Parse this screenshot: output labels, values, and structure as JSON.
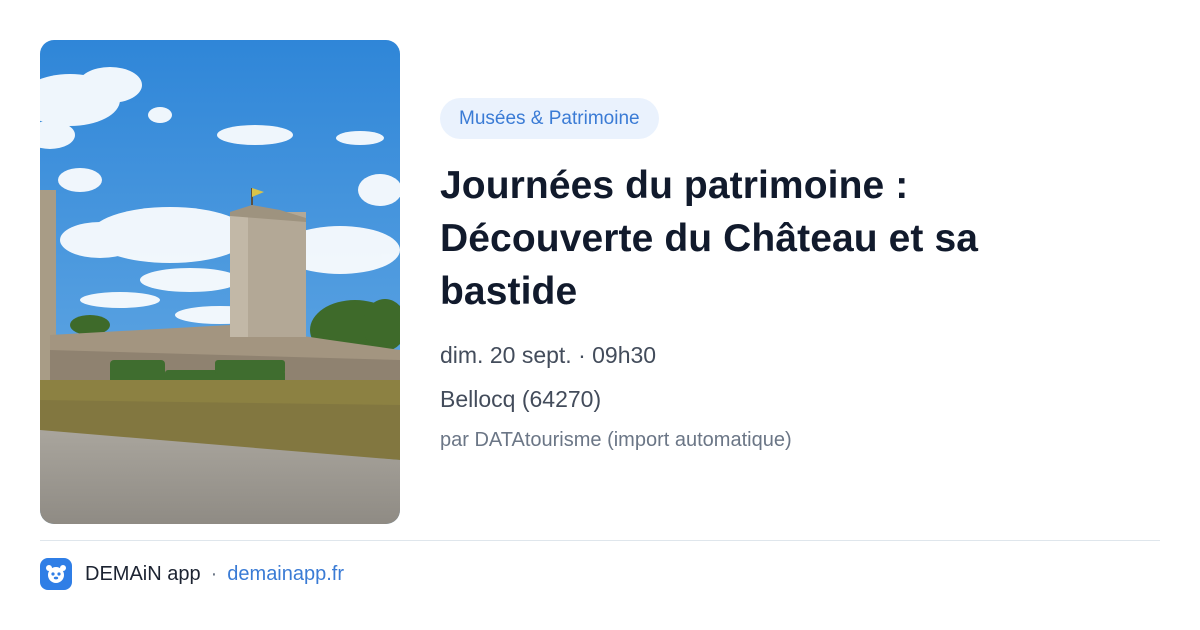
{
  "card": {
    "category": "Musées & Patrimoine",
    "title": "Journées du patrimoine : Découverte du Château et sa bastide",
    "date_time": "dim. 20 sept. · 09h30",
    "location": "Bellocq (64270)",
    "source": "par DATAtourisme (import automatique)"
  },
  "footer": {
    "app_name": "DEMAiN app",
    "separator": "·",
    "domain": "demainapp.fr"
  },
  "image": {
    "icon": "castle-photo",
    "colors": {
      "sky": "#3f8fd6",
      "grass": "#8a7f3e",
      "stone": "#b8ad9c"
    }
  },
  "colors": {
    "accent": "#3a7bd5",
    "tag_bg": "#eaf2fd",
    "title": "#111a2c"
  }
}
